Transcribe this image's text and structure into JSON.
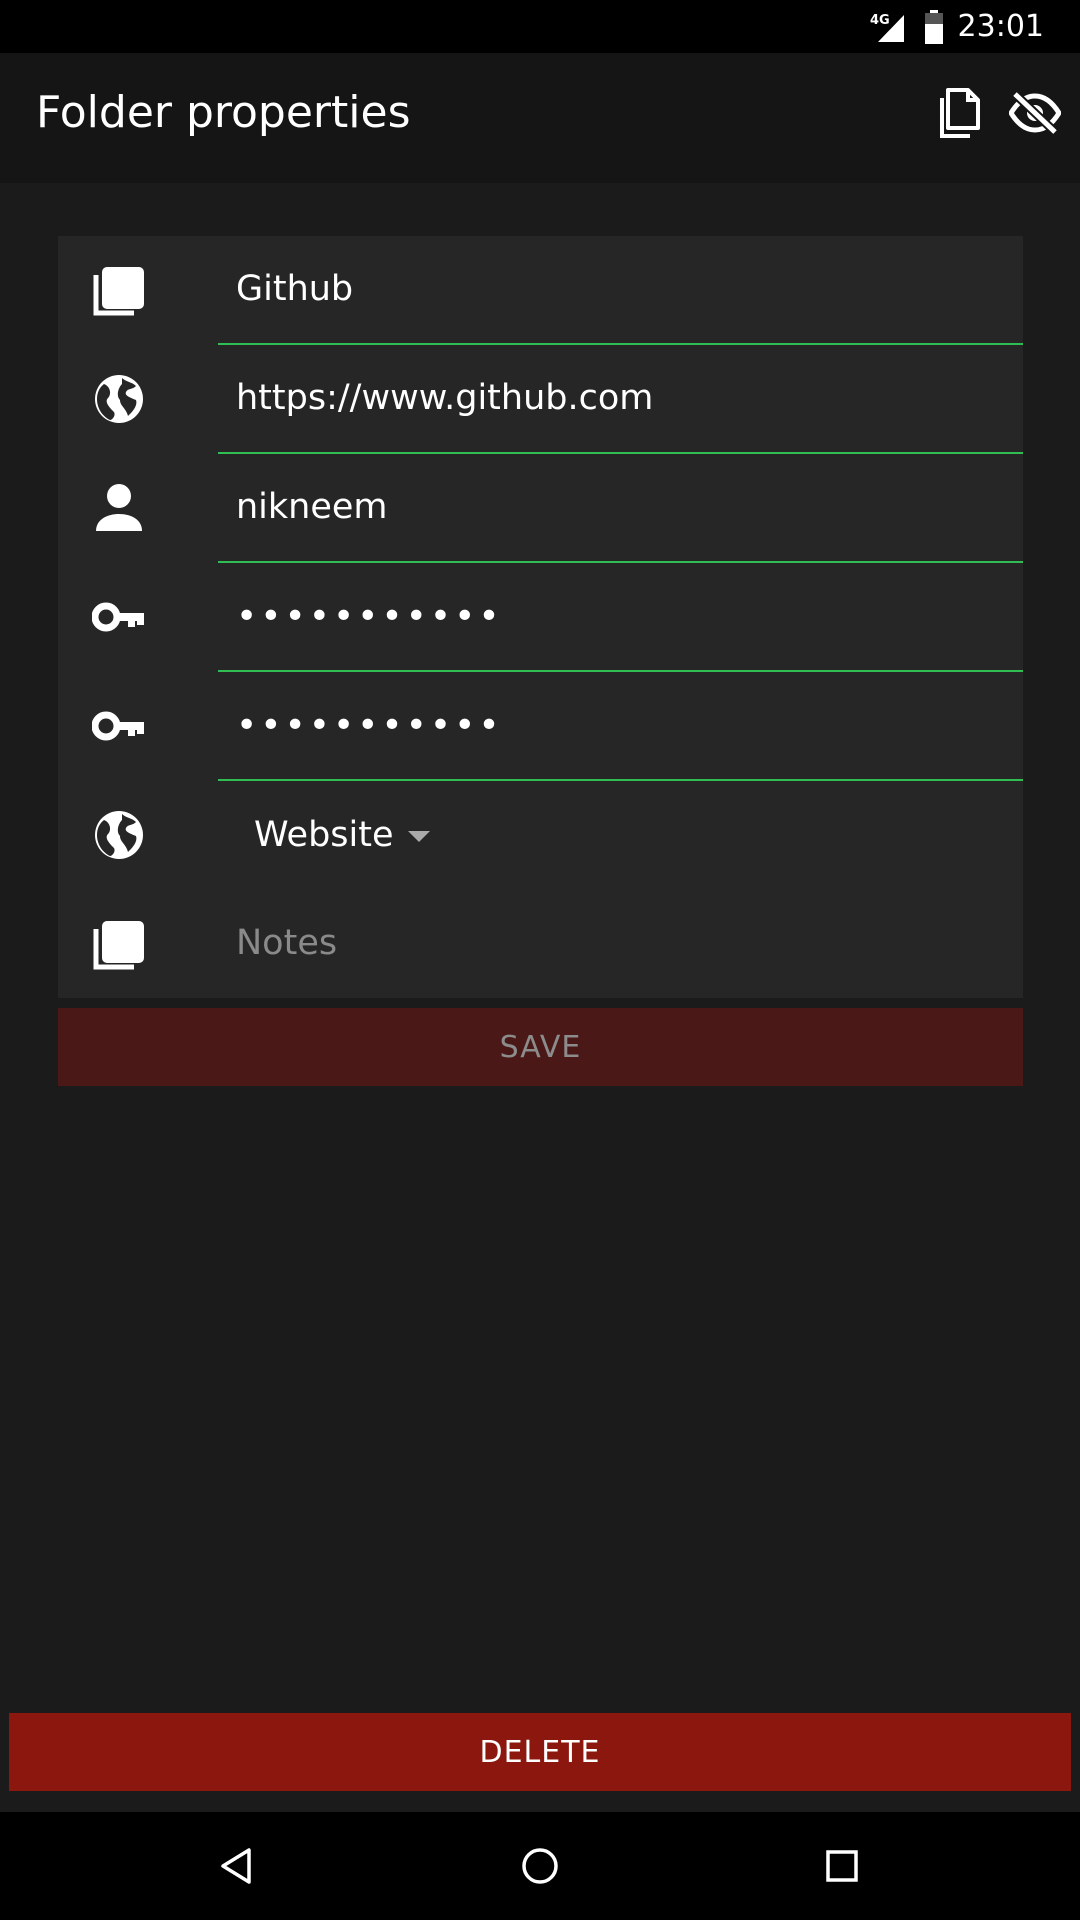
{
  "status_bar": {
    "network": "4G",
    "time": "23:01"
  },
  "app_bar": {
    "title": "Folder properties",
    "actions": [
      {
        "icon": "copy-icon"
      },
      {
        "icon": "visibility-off-icon"
      }
    ]
  },
  "form": {
    "name": {
      "icon": "folder-icon",
      "value": "Github"
    },
    "url": {
      "icon": "globe-icon",
      "value": "https://www.github.com"
    },
    "username": {
      "icon": "person-icon",
      "value": "nikneem"
    },
    "password": {
      "icon": "key-icon",
      "value": "•••••••••••"
    },
    "password_confirm": {
      "icon": "key-icon",
      "value": "•••••••••••"
    },
    "type": {
      "icon": "globe-icon",
      "selected": "Website"
    },
    "notes": {
      "icon": "notes-icon",
      "placeholder": "Notes"
    }
  },
  "buttons": {
    "save": "SAVE",
    "delete": "DELETE"
  },
  "colors": {
    "accent_line": "#2fbd54",
    "save_bg": "#4a1917",
    "delete_bg": "#8c170e"
  }
}
